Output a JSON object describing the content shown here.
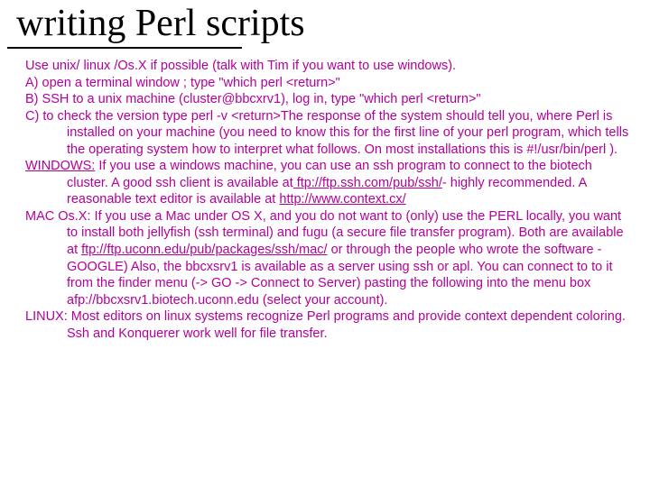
{
  "title": "writing Perl scripts",
  "intro": "Use unix/ linux /Os.X if possible (talk with Tim if you want to use windows).",
  "itemA": "A) open a terminal window ; type \"which perl <return>\"",
  "itemB": "B) SSH to a unix machine (cluster@bbcxrv1), log in, type \"which perl <return>\"",
  "itemC": "C) to check the version type perl -v <return>The response of the system should tell you, where Perl is installed on your machine (you need to know this for the first line of your perl program, which tells the operating system how to interpret what follows. On most installations this is #!/usr/bin/perl ).",
  "windows_label": "WINDOWS:",
  "windows_pre": " If you use a windows machine, you can use an ssh program to connect to the biotech cluster. A good ssh client is available at",
  "windows_link1": " ftp://ftp.ssh.com/pub/ssh/",
  "windows_mid": "- highly recommended. A reasonable text editor is available at ",
  "windows_link2": "http://www.context.cx/",
  "mac_pre": "MAC Os.X: If you use a Mac under OS X, and you do not want to (only) use the PERL locally, you want to install both jellyfish (ssh terminal) and fugu (a secure file transfer program). Both are available at ",
  "mac_link": "ftp://ftp.uconn.edu/pub/packages/ssh/mac/",
  "mac_post": " or through the people who wrote the software - GOOGLE)  Also, the bbcxsrv1 is available as a server using ssh or apl. You can connect to to it from the finder menu (-> GO -> Connect to Server) pasting the following into the menu box afp://bbcxsrv1.biotech.uconn.edu (select your account).",
  "linux": "LINUX: Most editors on linux systems recognize Perl programs and provide context dependent coloring. Ssh and Konquerer work well for file transfer."
}
